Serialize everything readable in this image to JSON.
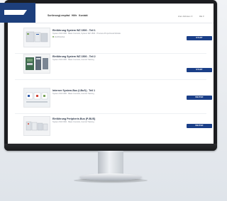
{
  "nav": {
    "items": [
      "Sortierung",
      "Lernpfad",
      "Hilfe",
      "Kontakt"
    ],
    "sort_label": "Zum Abholen",
    "lang_label": "DE"
  },
  "courses": [
    {
      "title": "Einführung System WZ 1500 - Teil 1",
      "subtitle": "System WZ 1500 · Basic Controls, System WZ 1500 · Process-Proportional Module",
      "badge": "Zertifizierbar",
      "button": "START"
    },
    {
      "title": "Einführung System WZ 1500 - Teil 2",
      "subtitle": "System WZ 1500 · Basic Controls, Control Training",
      "badge": "",
      "button": "START"
    },
    {
      "title": "Interner System-Bus (I-BuS) - Teil 1",
      "subtitle": "System WZ 1500 · Basic Controls, Control Training",
      "badge": "",
      "button": "WEITER"
    },
    {
      "title": "Einführung Peripherie-Bus (P-BUS)",
      "subtitle": "System WZ 1500 · Basic Controls, Control Training",
      "badge": "",
      "button": "WEITER"
    }
  ],
  "colors": {
    "brand": "#1d3f7c",
    "button": "#1b3f88",
    "bezel": "#1c1d20"
  }
}
